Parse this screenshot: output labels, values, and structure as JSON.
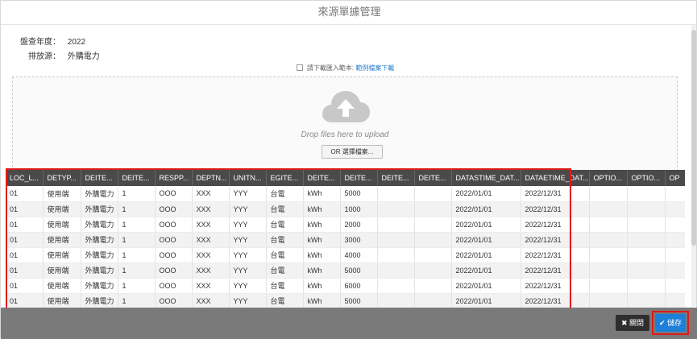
{
  "dialog": {
    "title": "來源單據管理"
  },
  "info": {
    "year_label": "盤查年度：",
    "year_value": "2022",
    "source_label": "排放源：",
    "source_value": "外購電力"
  },
  "hint": {
    "prefix": "請下載匯入範本:",
    "link": "範例檔案下載"
  },
  "dropzone": {
    "text": "Drop files here to upload",
    "button": "OR 選擇檔案..."
  },
  "grid": {
    "columns": [
      "LOC_L...",
      "DETYP...",
      "DEITE...",
      "DEITE...",
      "RESPP...",
      "DEPTN...",
      "UNITN...",
      "EGITE...",
      "DEITE...",
      "DEITE...",
      "DEITE...",
      "DEITE...",
      "DATASTIME_DAT...",
      "DATAETIME_DAT...",
      "OPTIO...",
      "OPTIO...",
      "OP"
    ],
    "rows": [
      [
        "01",
        "使用端",
        "外購電力",
        "1",
        "OOO",
        "XXX",
        "YYY",
        "台電",
        "kWh",
        "5000",
        "",
        "",
        "2022/01/01",
        "2022/12/31",
        "",
        "",
        ""
      ],
      [
        "01",
        "使用端",
        "外購電力",
        "1",
        "OOO",
        "XXX",
        "YYY",
        "台電",
        "kWh",
        "1000",
        "",
        "",
        "2022/01/01",
        "2022/12/31",
        "",
        "",
        ""
      ],
      [
        "01",
        "使用端",
        "外購電力",
        "1",
        "OOO",
        "XXX",
        "YYY",
        "台電",
        "kWh",
        "2000",
        "",
        "",
        "2022/01/01",
        "2022/12/31",
        "",
        "",
        ""
      ],
      [
        "01",
        "使用端",
        "外購電力",
        "1",
        "OOO",
        "XXX",
        "YYY",
        "台電",
        "kWh",
        "3000",
        "",
        "",
        "2022/01/01",
        "2022/12/31",
        "",
        "",
        ""
      ],
      [
        "01",
        "使用端",
        "外購電力",
        "1",
        "OOO",
        "XXX",
        "YYY",
        "台電",
        "kWh",
        "4000",
        "",
        "",
        "2022/01/01",
        "2022/12/31",
        "",
        "",
        ""
      ],
      [
        "01",
        "使用端",
        "外購電力",
        "1",
        "OOO",
        "XXX",
        "YYY",
        "台電",
        "kWh",
        "5000",
        "",
        "",
        "2022/01/01",
        "2022/12/31",
        "",
        "",
        ""
      ],
      [
        "01",
        "使用端",
        "外購電力",
        "1",
        "OOO",
        "XXX",
        "YYY",
        "台電",
        "kWh",
        "6000",
        "",
        "",
        "2022/01/01",
        "2022/12/31",
        "",
        "",
        ""
      ],
      [
        "01",
        "使用端",
        "外購電力",
        "1",
        "OOO",
        "XXX",
        "YYY",
        "台電",
        "kWh",
        "5000",
        "",
        "",
        "2022/01/01",
        "2022/12/31",
        "",
        "",
        ""
      ]
    ]
  },
  "footer": {
    "close_label": "關閉",
    "save_label": "儲存"
  },
  "colors": {
    "accent": "#1e7fd9",
    "highlight": "#e01818",
    "header_bg": "#4a4a4a"
  },
  "icons": {
    "upload": "cloud-upload-icon",
    "close": "close-icon",
    "save": "check-icon"
  }
}
